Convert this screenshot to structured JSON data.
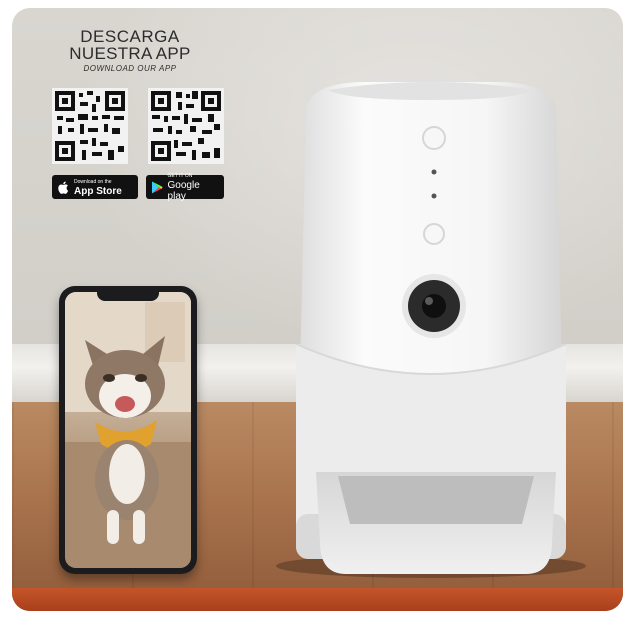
{
  "promo": {
    "line1": "DESCARGA",
    "line2": "NUESTRA APP",
    "line3": "DOWNLOAD OUR APP"
  },
  "stores": {
    "apple_small": "Download on the",
    "apple_big": "App Store",
    "google_small": "GET IT ON",
    "google_big": "Google play"
  },
  "icons": [
    "qr-code-icon",
    "apple-icon",
    "google-play-icon"
  ],
  "colors": {
    "wall": "#d2cfc9",
    "floor": "#a9744e",
    "feeder": "#f4f4f4",
    "accent_floor_edge": "#c5552a"
  }
}
